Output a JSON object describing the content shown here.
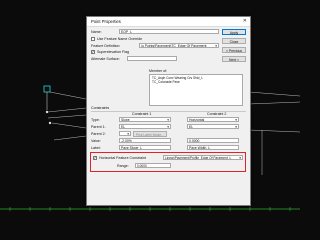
{
  "dialog": {
    "title": "Point Properties",
    "name_label": "Name:",
    "name_value": "EOP_L",
    "use_feature_name_override_label": "Use Feature Name Override",
    "feature_definition_label": "Feature Definition:",
    "feature_definition_value": "\\u Points\\Pavement\\TC_Edge Of Pavement",
    "superelevation_flag_label": "Superelevation Flag",
    "alternate_surface_label": "Alternate Surface:",
    "member_of_label": "Member of:",
    "member_of_items": [
      "TC_Asph Conc Wearing Crs Shld_L",
      "TC_Colonade Pave"
    ],
    "buttons": {
      "apply": "Apply",
      "close": "Close",
      "previous": "< Previous",
      "next": "Next >"
    },
    "constraints": {
      "heading": "Constraints",
      "col1": "Constraint 1",
      "col2": "Constraint 2",
      "type_label": "Type:",
      "type1": "Slope",
      "type2": "Horizontal",
      "parent1_label": "Parent 1:",
      "parent1_a": "EL",
      "parent1_b": "EL",
      "parent2_label": "Parent 2:",
      "pick_button": "Pick Label Mode...",
      "value_label": "Value:",
      "value1": "-2.00%",
      "value2": "0.0000",
      "label_label": "Label:",
      "label1": "Pave Slope_L",
      "label2": "Pave Width_L",
      "horizontal_feature_constraint_label": "Horizontal Feature Constraint",
      "hfc_value": "Linear\\Pavement\\Profile_Edge Of Pavement_L",
      "range_label": "Range:",
      "range_value": "0.0000"
    }
  },
  "colors": {
    "accent_highlight": "#e4202a",
    "grid_green": "#2fae2f",
    "cad_background": "#0b0b0b"
  }
}
